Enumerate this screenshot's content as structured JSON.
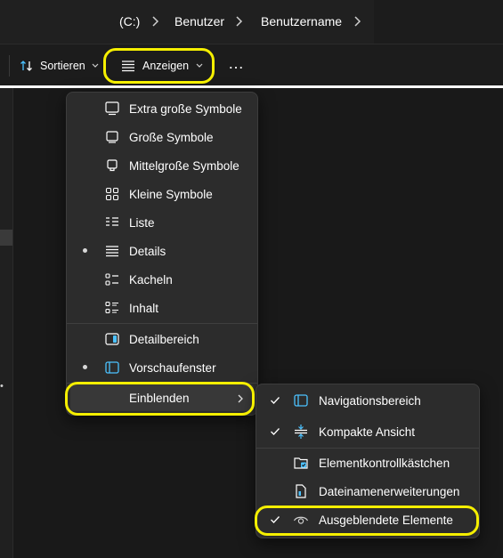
{
  "breadcrumb": {
    "items": [
      "(C:)",
      "Benutzer",
      "Benutzername"
    ]
  },
  "toolbar": {
    "sort_label": "Sortieren",
    "view_label": "Anzeigen",
    "more_label": "…"
  },
  "view_menu": {
    "items": [
      {
        "label": "Extra große Symbole",
        "icon": "monitor-xl-icon",
        "selected": false
      },
      {
        "label": "Große Symbole",
        "icon": "monitor-large-icon",
        "selected": false
      },
      {
        "label": "Mittelgroße Symbole",
        "icon": "monitor-medium-icon",
        "selected": false
      },
      {
        "label": "Kleine Symbole",
        "icon": "grid-small-icon",
        "selected": false
      },
      {
        "label": "Liste",
        "icon": "list-icon",
        "selected": false
      },
      {
        "label": "Details",
        "icon": "details-icon",
        "selected": true
      },
      {
        "label": "Kacheln",
        "icon": "tiles-icon",
        "selected": false
      },
      {
        "label": "Inhalt",
        "icon": "content-icon",
        "selected": false
      }
    ],
    "pane_items": [
      {
        "label": "Detailbereich",
        "icon": "details-pane-icon",
        "selected": false
      },
      {
        "label": "Vorschaufenster",
        "icon": "preview-pane-icon",
        "selected": true
      }
    ],
    "show": {
      "label": "Einblenden",
      "icon": "chevron-right-icon"
    }
  },
  "show_menu": {
    "items": [
      {
        "label": "Navigationsbereich",
        "icon": "nav-pane-icon",
        "checked": true
      },
      {
        "label": "Kompakte Ansicht",
        "icon": "compact-view-icon",
        "checked": true
      },
      {
        "label": "Elementkontrollkästchen",
        "icon": "checkbox-folder-icon",
        "checked": false
      },
      {
        "label": "Dateinamenerweiterungen",
        "icon": "file-extension-icon",
        "checked": false
      },
      {
        "label": "Ausgeblendete Elemente",
        "icon": "eye-icon",
        "checked": true
      }
    ]
  },
  "colors": {
    "highlight": "#f5ef00",
    "accent": "#4cc2ff",
    "menu_bg": "#2c2c2c"
  }
}
